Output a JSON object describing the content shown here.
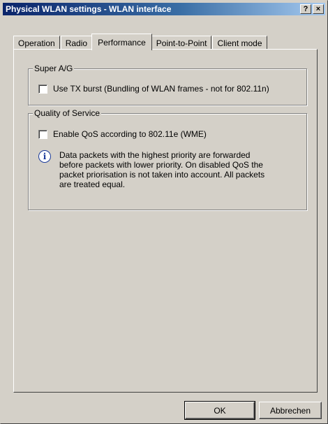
{
  "window": {
    "title": "Physical WLAN settings - WLAN interface",
    "help_label": "?",
    "close_label": "×"
  },
  "tabs": [
    {
      "label": "Operation",
      "active": false
    },
    {
      "label": "Radio",
      "active": false
    },
    {
      "label": "Performance",
      "active": true
    },
    {
      "label": "Point-to-Point",
      "active": false
    },
    {
      "label": "Client mode",
      "active": false
    }
  ],
  "super_ag": {
    "legend": "Super A/G",
    "tx_burst_label": "Use TX burst (Bundling of WLAN frames - not for 802.11n)",
    "tx_burst_checked": false
  },
  "qos": {
    "legend": "Quality of Service",
    "enable_label": "Enable QoS according to 802.11e (WME)",
    "enable_checked": false,
    "info_icon": "info-icon",
    "info_lines": [
      "Data packets with the highest priority are forwarded",
      "before packets with lower priority. On disabled QoS the",
      "packet priorisation is not taken into account. All packets",
      "are treated equal."
    ]
  },
  "buttons": {
    "ok": "OK",
    "cancel": "Abbrechen"
  }
}
